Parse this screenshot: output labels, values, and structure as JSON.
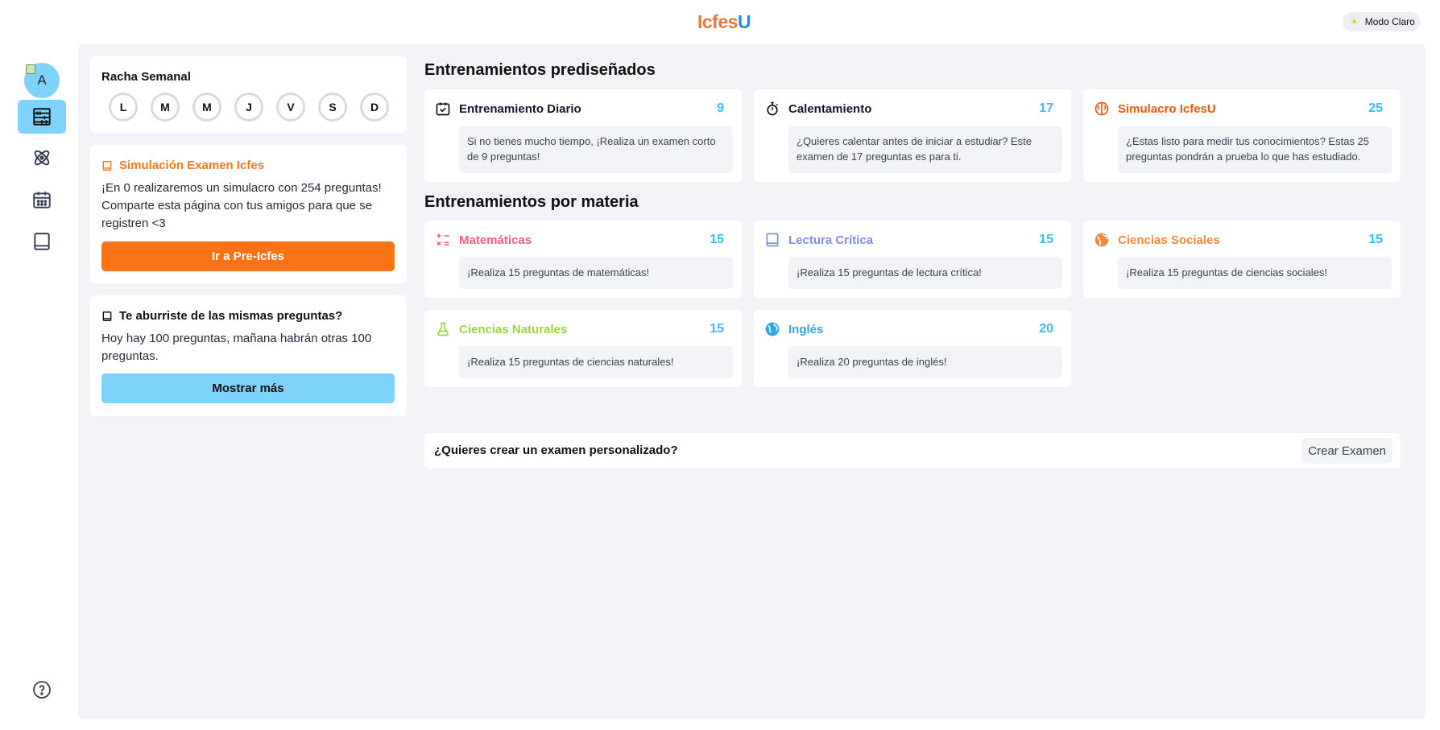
{
  "header": {
    "logo_part1": "Icfes",
    "logo_part2": "U",
    "mode_label": "Modo Claro"
  },
  "sidebar": {
    "avatar_text": "A",
    "items": [
      {
        "name": "abacus-icon",
        "active": true
      },
      {
        "name": "atom-icon",
        "active": false
      },
      {
        "name": "calendar-icon",
        "active": false
      },
      {
        "name": "book-icon",
        "active": false
      }
    ]
  },
  "streak": {
    "title": "Racha Semanal",
    "days": [
      "L",
      "M",
      "M",
      "J",
      "V",
      "S",
      "D"
    ]
  },
  "simulation": {
    "title": "Simulación Examen Icfes",
    "text": "¡En 0 realizaremos un simulacro con 254 preguntas! Comparte esta página con tus amigos para que se registren <3",
    "button": "Ir a Pre-Icfes"
  },
  "bored": {
    "title": "Te aburriste de las mismas preguntas?",
    "text": "Hoy hay 100 preguntas, mañana habrán otras 100 preguntas.",
    "button": "Mostrar más"
  },
  "predesigned": {
    "title": "Entrenamientos prediseñados",
    "items": [
      {
        "title": "Entrenamiento Diario",
        "count": "9",
        "desc": "Si no tienes mucho tiempo, ¡Realiza un examen corto de 9 preguntas!",
        "icon": "calendar-check-icon",
        "color": "#111827"
      },
      {
        "title": "Calentamiento",
        "count": "17",
        "desc": "¿Quieres calentar antes de iniciar a estudiar? Este examen de 17 preguntas es para ti.",
        "icon": "stopwatch-icon",
        "color": "#111827"
      },
      {
        "title": "Simulacro IcfesU",
        "count": "25",
        "desc": "¿Estas listo para medir tus conocimientos? Estas 25 preguntas pondrán a prueba lo que has estudiado.",
        "icon": "brain-icon",
        "color": "#ea580c"
      }
    ]
  },
  "subjects": {
    "title": "Entrenamientos por materia",
    "items": [
      {
        "title": "Matemáticas",
        "count": "15",
        "desc": "¡Realiza 15 preguntas de matemáticas!",
        "icon": "math-symbols-icon",
        "color": "#f0607a"
      },
      {
        "title": "Lectura Crítica",
        "count": "15",
        "desc": "¡Realiza 15 preguntas de lectura crítica!",
        "icon": "book-icon",
        "color": "#7c8ee8"
      },
      {
        "title": "Ciencias Sociales",
        "count": "15",
        "desc": "¡Realiza 15 preguntas de ciencias sociales!",
        "icon": "globe-icon",
        "color": "#f28a3c"
      },
      {
        "title": "Ciencias Naturales",
        "count": "15",
        "desc": "¡Realiza 15 preguntas de ciencias naturales!",
        "icon": "flask-icon",
        "color": "#9bd53c"
      },
      {
        "title": "Inglés",
        "count": "20",
        "desc": "¡Realiza 20 preguntas de inglés!",
        "icon": "earth-icon",
        "color": "#2fa6e8"
      }
    ]
  },
  "custom": {
    "question": "¿Quieres crear un examen personalizado?",
    "button": "Crear Examen"
  }
}
